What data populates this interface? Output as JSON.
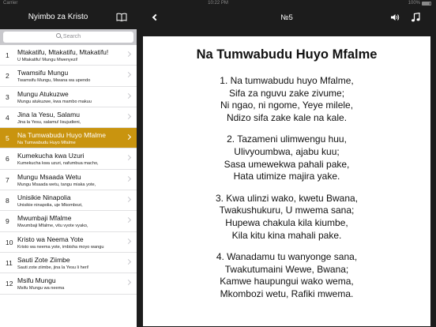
{
  "status": {
    "carrier": "Carrier",
    "time": "10:22 PM",
    "battery": "100%"
  },
  "left": {
    "title": "Nyimbo za Kristo",
    "search_placeholder": "Search",
    "items": [
      {
        "n": "1",
        "title": "Mtakatifu, Mtakatifu, Mtakatifu!",
        "sub": "U Mtakatifu! Mungu Mwenyezi!"
      },
      {
        "n": "2",
        "title": "Twamsifu Mungu",
        "sub": "Twamsifu Mungu, Mwana wa upendo"
      },
      {
        "n": "3",
        "title": "Mungu Atukuzwe",
        "sub": "Mungu atukuzwe, kwa mambo makuu"
      },
      {
        "n": "4",
        "title": "Jina la Yesu, Salamu",
        "sub": "Jina la Yesu, salamu! lisujudieni,"
      },
      {
        "n": "5",
        "title": "Na Tumwabudu Huyo Mfalme",
        "sub": "Na Tumwabudu Huyo Mfalme"
      },
      {
        "n": "6",
        "title": "Kumekucha kwa Uzuri",
        "sub": "Kumekucha kwa uzuri, nafumbua macho,"
      },
      {
        "n": "7",
        "title": "Mungu Msaada Wetu",
        "sub": "Mungu Msaada wetu, tangu miaka yote,"
      },
      {
        "n": "8",
        "title": "Unisikie Ninapolia",
        "sub": "Unisikie ninapolia, uje Mkombozi,"
      },
      {
        "n": "9",
        "title": "Mwumbaji Mfalme",
        "sub": "Mwumbaji Mfalme, vitu vyote vyako,"
      },
      {
        "n": "10",
        "title": "Kristo wa Neema Yote",
        "sub": "Kristo wa neema yote, imbisha moyo wangu"
      },
      {
        "n": "11",
        "title": "Sauti Zote Ziimbe",
        "sub": "Sauti zote ziimbe, jina la Yesu li heri!"
      },
      {
        "n": "12",
        "title": "Msifu Mungu",
        "sub": "Msifu Mungu wa neema"
      }
    ]
  },
  "right": {
    "number": "№5",
    "song_title": "Na Tumwabudu Huyo Mfalme",
    "stanzas": [
      [
        "1. Na tumwabudu huyo Mfalme,",
        "Sifa za nguvu zake zivume;",
        "Ni ngao, ni ngome, Yeye milele,",
        "Ndizo sifa zake kale na kale."
      ],
      [
        "2. Tazameni ulimwengu huu,",
        "Ulivyoumbwa, ajabu kuu;",
        "Sasa umewekwa pahali pake,",
        "Hata utimize majira yake."
      ],
      [
        "3. Kwa ulinzi wako, kwetu Bwana,",
        "Twakushukuru, U mwema sana;",
        "Hupewa chakula kila kiumbe,",
        "Kila kitu kina mahali pake."
      ],
      [
        "4. Wanadamu tu wanyonge sana,",
        "Twakutumaini Wewe, Bwana;",
        "Kamwe haupungui wako wema,",
        "Mkombozi wetu, Rafiki mwema."
      ]
    ]
  }
}
